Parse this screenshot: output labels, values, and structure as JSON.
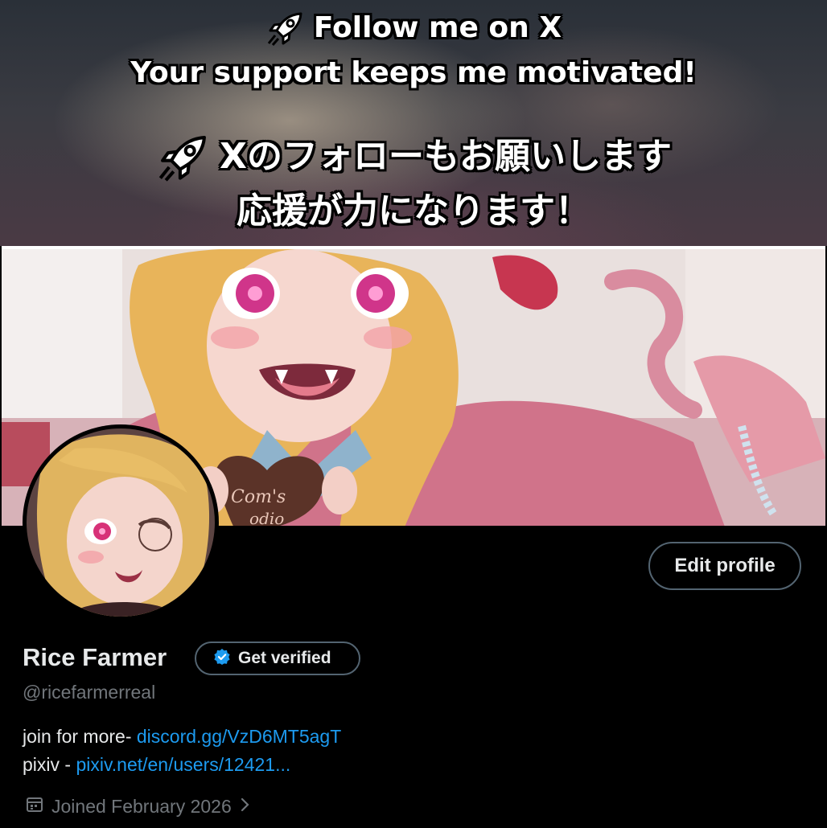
{
  "promo": {
    "line1": "Follow me on X",
    "line2": "Your support keeps me motivated!",
    "line3": "Xのフォローもお願いします",
    "line4": "応援が力になります！"
  },
  "header_art": {
    "chocolate_text_1": "Com's",
    "chocolate_text_2": "odio"
  },
  "profile": {
    "display_name": "Rice Farmer",
    "verify_label": "Get verified",
    "handle": "@ricefarmerreal",
    "edit_label": "Edit profile",
    "bio": {
      "line1_prefix": "join for more- ",
      "line1_link": "discord.gg/VzD6MT5agT",
      "line2_prefix": "pixiv - ",
      "line2_link": "pixiv.net/en/users/12421..."
    },
    "joined": "Joined February 2026"
  },
  "colors": {
    "background": "#000000",
    "text_primary": "#e7e9ea",
    "text_secondary": "#71767b",
    "link": "#1d9bf0",
    "button_border": "#536471"
  },
  "icons": [
    "rocket-icon",
    "verified-badge-icon",
    "calendar-icon",
    "chevron-right-icon"
  ]
}
